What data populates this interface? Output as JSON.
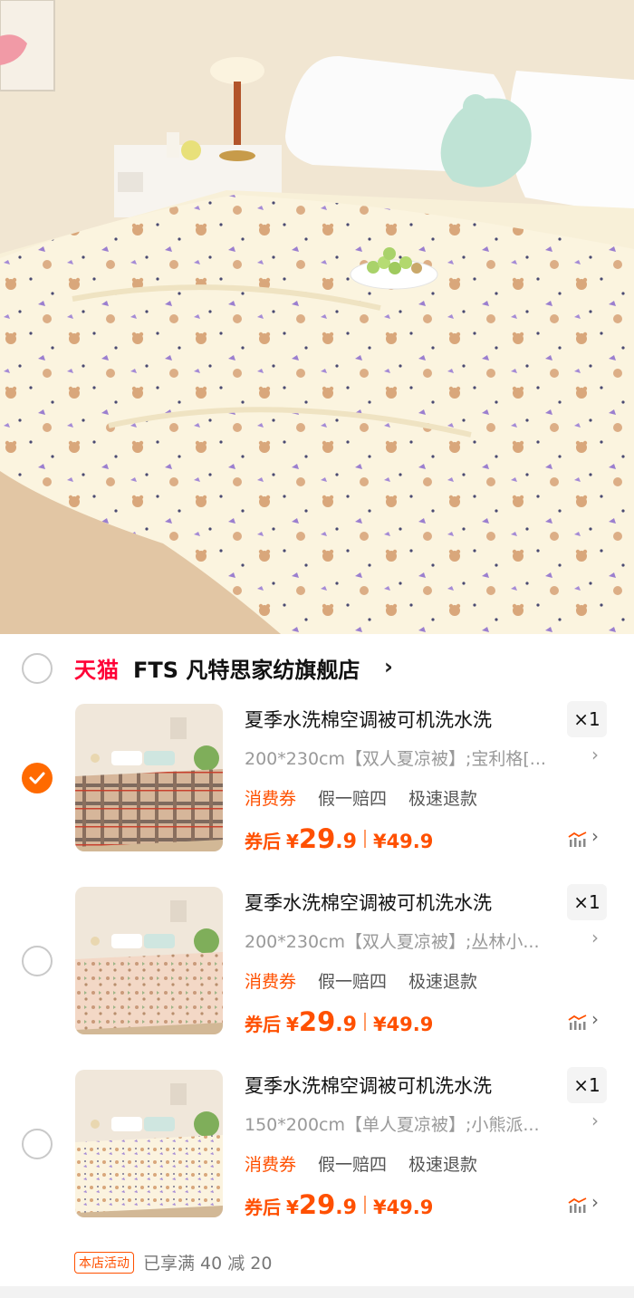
{
  "shop": {
    "platform_logo": "天猫",
    "name": "FTS 凡特思家纺旗舰店",
    "chevron": "›",
    "selected": false
  },
  "items": [
    {
      "selected": true,
      "title": "夏季水洗棉空调被可机洗水洗",
      "quantity": "×1",
      "sku": "200*230cm【双人夏凉被】;宝利格[...",
      "tags": [
        "消费券",
        "假一赔四",
        "极速退款"
      ],
      "after_coupon_label": "券后",
      "currency": "¥",
      "price_main": "29",
      "price_decimal": ".9",
      "original_price": "¥49.9",
      "pattern": "plaid"
    },
    {
      "selected": false,
      "title": "夏季水洗棉空调被可机洗水洗",
      "quantity": "×1",
      "sku": "200*230cm【双人夏凉被】;丛林小...",
      "tags": [
        "消费券",
        "假一赔四",
        "极速退款"
      ],
      "after_coupon_label": "券后",
      "currency": "¥",
      "price_main": "29",
      "price_decimal": ".9",
      "original_price": "¥49.9",
      "pattern": "jungle"
    },
    {
      "selected": false,
      "title": "夏季水洗棉空调被可机洗水洗",
      "quantity": "×1",
      "sku": "150*200cm【单人夏凉被】;小熊派...",
      "tags": [
        "消费券",
        "假一赔四",
        "极速退款"
      ],
      "after_coupon_label": "券后",
      "currency": "¥",
      "price_main": "29",
      "price_decimal": ".9",
      "original_price": "¥49.9",
      "pattern": "bear"
    }
  ],
  "promo": {
    "badge": "本店活动",
    "text": "已享满 40 减 20"
  },
  "icons": {
    "checkmark": "check-icon",
    "price_trend": "price-trend-icon",
    "chevron": "chevron-right-icon"
  },
  "colors": {
    "accent": "#ff5000",
    "tmall_red": "#ff0036",
    "checked": "#ff6a00"
  }
}
